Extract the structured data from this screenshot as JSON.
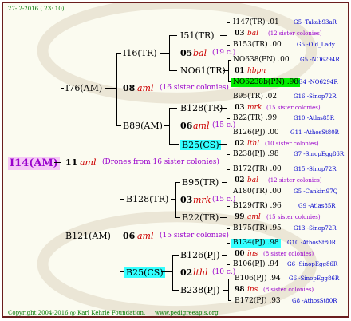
{
  "header": {
    "date": "27-  2-2016 ( 23: 10)"
  },
  "footer": {
    "copyright": "Copyright 2004-2016 @ Karl Kehrle Foundation.",
    "url": "www.pedigreeapis.org"
  },
  "root": {
    "label": "I14(AM)"
  },
  "gen1": {
    "num": "11",
    "sym": "aml",
    "note": "(Drones from 16 sister colonies)",
    "sire": "I76(AM)",
    "dam": "B121(AM)"
  },
  "gen2": [
    {
      "sire": "I16(TR)",
      "num": "08",
      "sym": "aml",
      "note": "(16 sister colonies)",
      "dam": "B89(AM)"
    },
    {
      "sire": "B128(TR)",
      "num": "06",
      "sym": "aml",
      "note": "(15 sister colonies)",
      "dam": "B25(CS)"
    }
  ],
  "gen3": [
    {
      "sire": "I51(TR)",
      "num": "05",
      "sym": "bal",
      "note": "(19 c.)",
      "dam": "NO61(TR)"
    },
    {
      "sire": "B128(TR)",
      "num": "06",
      "sym": "aml",
      "note": "(15 c.)",
      "dam": "B25(CS)"
    },
    {
      "sire": "B95(TR)",
      "num": "03",
      "sym": "mrk",
      "note": "(15 c.)",
      "dam": "B22(TR)"
    },
    {
      "sire": "B126(PJ)",
      "num": "02",
      "sym": "lthl",
      "note": "(10 c.)",
      "dam": "B238(PJ)"
    }
  ],
  "gen4": [
    {
      "top": "I147(TR) .01",
      "top_code": "G5 -Takab93aR",
      "num": "03",
      "sym": "bal",
      "note": "(12 sister colonies)",
      "bot": "B153(TR) .00",
      "bot_code": "G5 -Old_Lady"
    },
    {
      "top": "NO638(PN) .00",
      "top_code": "G5 -NO6294R",
      "num": "01",
      "sym": "hbpn",
      "note": "",
      "bot": "NO6238b(PN) .98",
      "bot_code": "G4 -NO6294R"
    },
    {
      "top": "B95(TR) .02",
      "top_code": "G16 -Sinop72R",
      "num": "03",
      "sym": "mrk",
      "note": "(15 sister colonies)",
      "bot": "B22(TR) .99",
      "bot_code": "G10 -Atlas85R"
    },
    {
      "top": "B126(PJ) .00",
      "top_code": "G11 -AthosSt80R",
      "num": "02",
      "sym": "lthl",
      "note": "(10 sister colonies)",
      "bot": "B238(PJ) .98",
      "bot_code": "G7 -SinopEgg86R"
    },
    {
      "top": "B172(TR) .00",
      "top_code": "G15 -Sinop72R",
      "num": "02",
      "sym": "bal",
      "note": "(12 sister colonies)",
      "bot": "A180(TR) .00",
      "bot_code": "G5 -Cankiri97Q"
    },
    {
      "top": "B129(TR) .96",
      "top_code": "G9 -Atlas85R",
      "num": "99",
      "sym": "aml",
      "note": "(15 sister colonies)",
      "bot": "B175(TR) .95",
      "bot_code": "G13 -Sinop72R"
    },
    {
      "top": "B134(PJ) .98",
      "top_code": "G10 -AthosSt80R",
      "num": "00",
      "sym": "ins",
      "note": "(8 sister colonies)",
      "bot": "B106(PJ) .94",
      "bot_code": "G6 -SinopEgg86R"
    },
    {
      "top": "B106(PJ) .94",
      "top_code": "G6 -SinopEgg86R",
      "num": "98",
      "sym": "ins",
      "note": "(8 sister colonies)",
      "bot": "B172(PJ) .93",
      "bot_code": "G8 -AthosSt80R"
    }
  ]
}
